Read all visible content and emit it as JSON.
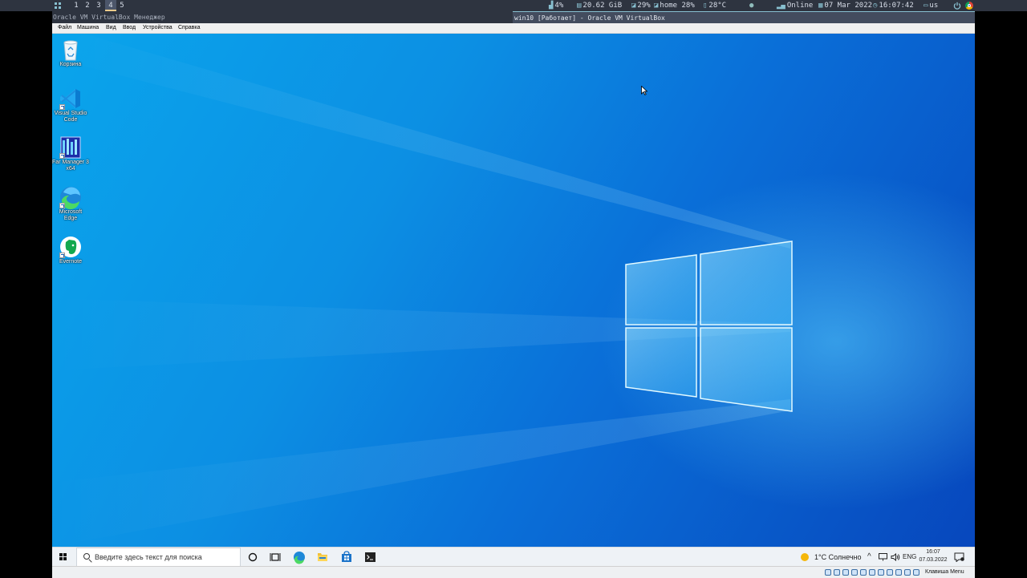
{
  "wm_bar": {
    "workspaces": [
      "1",
      "2",
      "3",
      "4",
      "5"
    ],
    "active_workspace": "4",
    "cpu": "4%",
    "memory": "20.62 GiB",
    "disk_root": "29%",
    "disk_home": "home 28%",
    "temperature": "28°C",
    "network": "Online",
    "date": "07 Mar 2022",
    "time": "16:07:42",
    "keyboard_layout": "us"
  },
  "window": {
    "left_title": "Oracle VM VirtualBox Менеджер",
    "right_title": "win10 [Работает] - Oracle VM VirtualBox"
  },
  "vbox_menu": {
    "items": [
      "Файл",
      "Машина",
      "Вид",
      "Ввод",
      "Устройства",
      "Справка"
    ]
  },
  "desktop_icons": [
    {
      "label": "Корзина",
      "icon": "recycle-bin-icon"
    },
    {
      "label": "Visual Studio Code",
      "icon": "vscode-icon"
    },
    {
      "label": "Far Manager 3 x64",
      "icon": "far-manager-icon"
    },
    {
      "label": "Microsoft Edge",
      "icon": "edge-icon"
    },
    {
      "label": "Evernote",
      "icon": "evernote-icon"
    }
  ],
  "taskbar": {
    "search_placeholder": "Введите здесь текст для поиска",
    "pinned_icons": [
      "cortana-icon",
      "task-view-icon",
      "edge-icon",
      "file-explorer-icon",
      "store-icon",
      "terminal-icon"
    ],
    "weather": "1°C  Солнечно",
    "language": "ENG",
    "clock_time": "16:07",
    "clock_date": "07.03.2022"
  },
  "vbox_status": {
    "host_key": "Клавиша Menu"
  },
  "colors": {
    "desktop_light": "#0aa5ec",
    "desktop_dark": "#0747bd",
    "wm_bar_bg": "#2e3440",
    "taskbar_bg": "#eef2f6"
  }
}
